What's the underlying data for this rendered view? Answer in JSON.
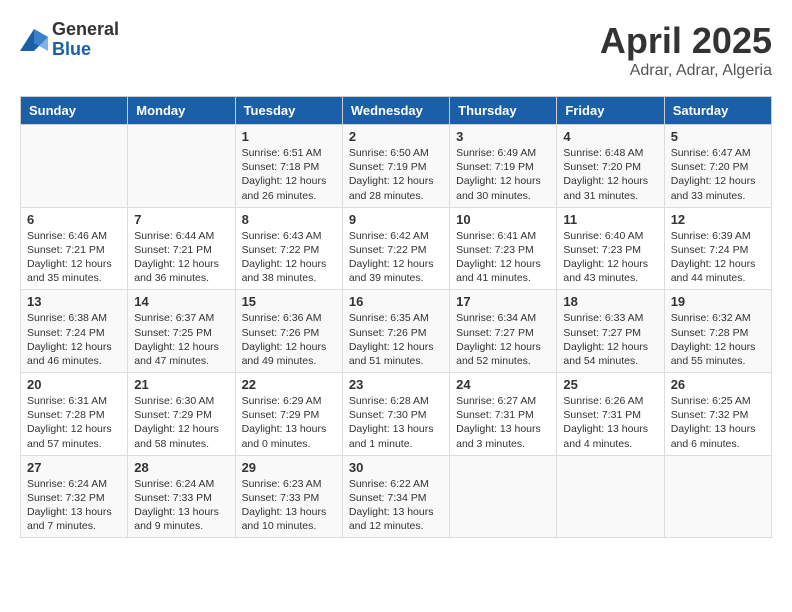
{
  "logo": {
    "general": "General",
    "blue": "Blue"
  },
  "header": {
    "month": "April 2025",
    "location": "Adrar, Adrar, Algeria"
  },
  "weekdays": [
    "Sunday",
    "Monday",
    "Tuesday",
    "Wednesday",
    "Thursday",
    "Friday",
    "Saturday"
  ],
  "weeks": [
    [
      {
        "day": "",
        "text": ""
      },
      {
        "day": "",
        "text": ""
      },
      {
        "day": "1",
        "text": "Sunrise: 6:51 AM\nSunset: 7:18 PM\nDaylight: 12 hours and 26 minutes."
      },
      {
        "day": "2",
        "text": "Sunrise: 6:50 AM\nSunset: 7:19 PM\nDaylight: 12 hours and 28 minutes."
      },
      {
        "day": "3",
        "text": "Sunrise: 6:49 AM\nSunset: 7:19 PM\nDaylight: 12 hours and 30 minutes."
      },
      {
        "day": "4",
        "text": "Sunrise: 6:48 AM\nSunset: 7:20 PM\nDaylight: 12 hours and 31 minutes."
      },
      {
        "day": "5",
        "text": "Sunrise: 6:47 AM\nSunset: 7:20 PM\nDaylight: 12 hours and 33 minutes."
      }
    ],
    [
      {
        "day": "6",
        "text": "Sunrise: 6:46 AM\nSunset: 7:21 PM\nDaylight: 12 hours and 35 minutes."
      },
      {
        "day": "7",
        "text": "Sunrise: 6:44 AM\nSunset: 7:21 PM\nDaylight: 12 hours and 36 minutes."
      },
      {
        "day": "8",
        "text": "Sunrise: 6:43 AM\nSunset: 7:22 PM\nDaylight: 12 hours and 38 minutes."
      },
      {
        "day": "9",
        "text": "Sunrise: 6:42 AM\nSunset: 7:22 PM\nDaylight: 12 hours and 39 minutes."
      },
      {
        "day": "10",
        "text": "Sunrise: 6:41 AM\nSunset: 7:23 PM\nDaylight: 12 hours and 41 minutes."
      },
      {
        "day": "11",
        "text": "Sunrise: 6:40 AM\nSunset: 7:23 PM\nDaylight: 12 hours and 43 minutes."
      },
      {
        "day": "12",
        "text": "Sunrise: 6:39 AM\nSunset: 7:24 PM\nDaylight: 12 hours and 44 minutes."
      }
    ],
    [
      {
        "day": "13",
        "text": "Sunrise: 6:38 AM\nSunset: 7:24 PM\nDaylight: 12 hours and 46 minutes."
      },
      {
        "day": "14",
        "text": "Sunrise: 6:37 AM\nSunset: 7:25 PM\nDaylight: 12 hours and 47 minutes."
      },
      {
        "day": "15",
        "text": "Sunrise: 6:36 AM\nSunset: 7:26 PM\nDaylight: 12 hours and 49 minutes."
      },
      {
        "day": "16",
        "text": "Sunrise: 6:35 AM\nSunset: 7:26 PM\nDaylight: 12 hours and 51 minutes."
      },
      {
        "day": "17",
        "text": "Sunrise: 6:34 AM\nSunset: 7:27 PM\nDaylight: 12 hours and 52 minutes."
      },
      {
        "day": "18",
        "text": "Sunrise: 6:33 AM\nSunset: 7:27 PM\nDaylight: 12 hours and 54 minutes."
      },
      {
        "day": "19",
        "text": "Sunrise: 6:32 AM\nSunset: 7:28 PM\nDaylight: 12 hours and 55 minutes."
      }
    ],
    [
      {
        "day": "20",
        "text": "Sunrise: 6:31 AM\nSunset: 7:28 PM\nDaylight: 12 hours and 57 minutes."
      },
      {
        "day": "21",
        "text": "Sunrise: 6:30 AM\nSunset: 7:29 PM\nDaylight: 12 hours and 58 minutes."
      },
      {
        "day": "22",
        "text": "Sunrise: 6:29 AM\nSunset: 7:29 PM\nDaylight: 13 hours and 0 minutes."
      },
      {
        "day": "23",
        "text": "Sunrise: 6:28 AM\nSunset: 7:30 PM\nDaylight: 13 hours and 1 minute."
      },
      {
        "day": "24",
        "text": "Sunrise: 6:27 AM\nSunset: 7:31 PM\nDaylight: 13 hours and 3 minutes."
      },
      {
        "day": "25",
        "text": "Sunrise: 6:26 AM\nSunset: 7:31 PM\nDaylight: 13 hours and 4 minutes."
      },
      {
        "day": "26",
        "text": "Sunrise: 6:25 AM\nSunset: 7:32 PM\nDaylight: 13 hours and 6 minutes."
      }
    ],
    [
      {
        "day": "27",
        "text": "Sunrise: 6:24 AM\nSunset: 7:32 PM\nDaylight: 13 hours and 7 minutes."
      },
      {
        "day": "28",
        "text": "Sunrise: 6:24 AM\nSunset: 7:33 PM\nDaylight: 13 hours and 9 minutes."
      },
      {
        "day": "29",
        "text": "Sunrise: 6:23 AM\nSunset: 7:33 PM\nDaylight: 13 hours and 10 minutes."
      },
      {
        "day": "30",
        "text": "Sunrise: 6:22 AM\nSunset: 7:34 PM\nDaylight: 13 hours and 12 minutes."
      },
      {
        "day": "",
        "text": ""
      },
      {
        "day": "",
        "text": ""
      },
      {
        "day": "",
        "text": ""
      }
    ]
  ]
}
